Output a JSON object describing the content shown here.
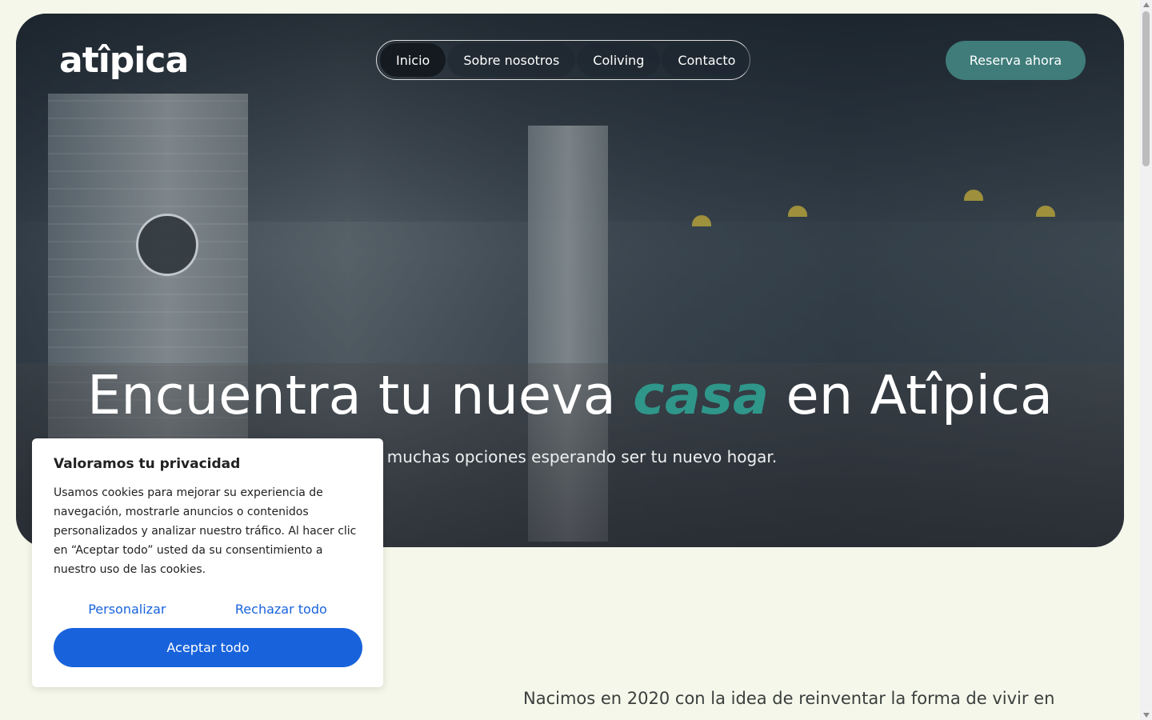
{
  "header": {
    "logo_text": "atîpica",
    "nav": [
      {
        "label": "Inicio",
        "active": true
      },
      {
        "label": "Sobre nosotros",
        "active": false
      },
      {
        "label": "Coliving",
        "active": false
      },
      {
        "label": "Contacto",
        "active": false
      }
    ],
    "cta_label": "Reserva ahora"
  },
  "hero": {
    "title_before": "Encuentra tu nueva",
    "title_accent": "casa",
    "title_after": "en Atîpica",
    "subtitle": "muchas opciones esperando ser tu nuevo hogar."
  },
  "intro": {
    "text": "Nacimos en 2020 con la idea de reinventar la forma de vivir en"
  },
  "cookie": {
    "title": "Valoramos tu privacidad",
    "text": "Usamos cookies para mejorar su experiencia de navegación, mostrarle anuncios o contenidos personalizados y analizar nuestro tráfico. Al hacer clic en “Aceptar todo” usted da su consentimiento a nuestro uso de las cookies.",
    "customize_label": "Personalizar",
    "reject_label": "Rechazar todo",
    "accept_label": "Aceptar todo"
  },
  "colors": {
    "page_bg": "#f5f7ea",
    "accent_teal": "#2f968a",
    "cta_bg": "#3f7c7a",
    "cookie_blue": "#1863dc"
  },
  "icons": [
    "scroll-up-arrow-icon",
    "scroll-down-arrow-icon"
  ]
}
